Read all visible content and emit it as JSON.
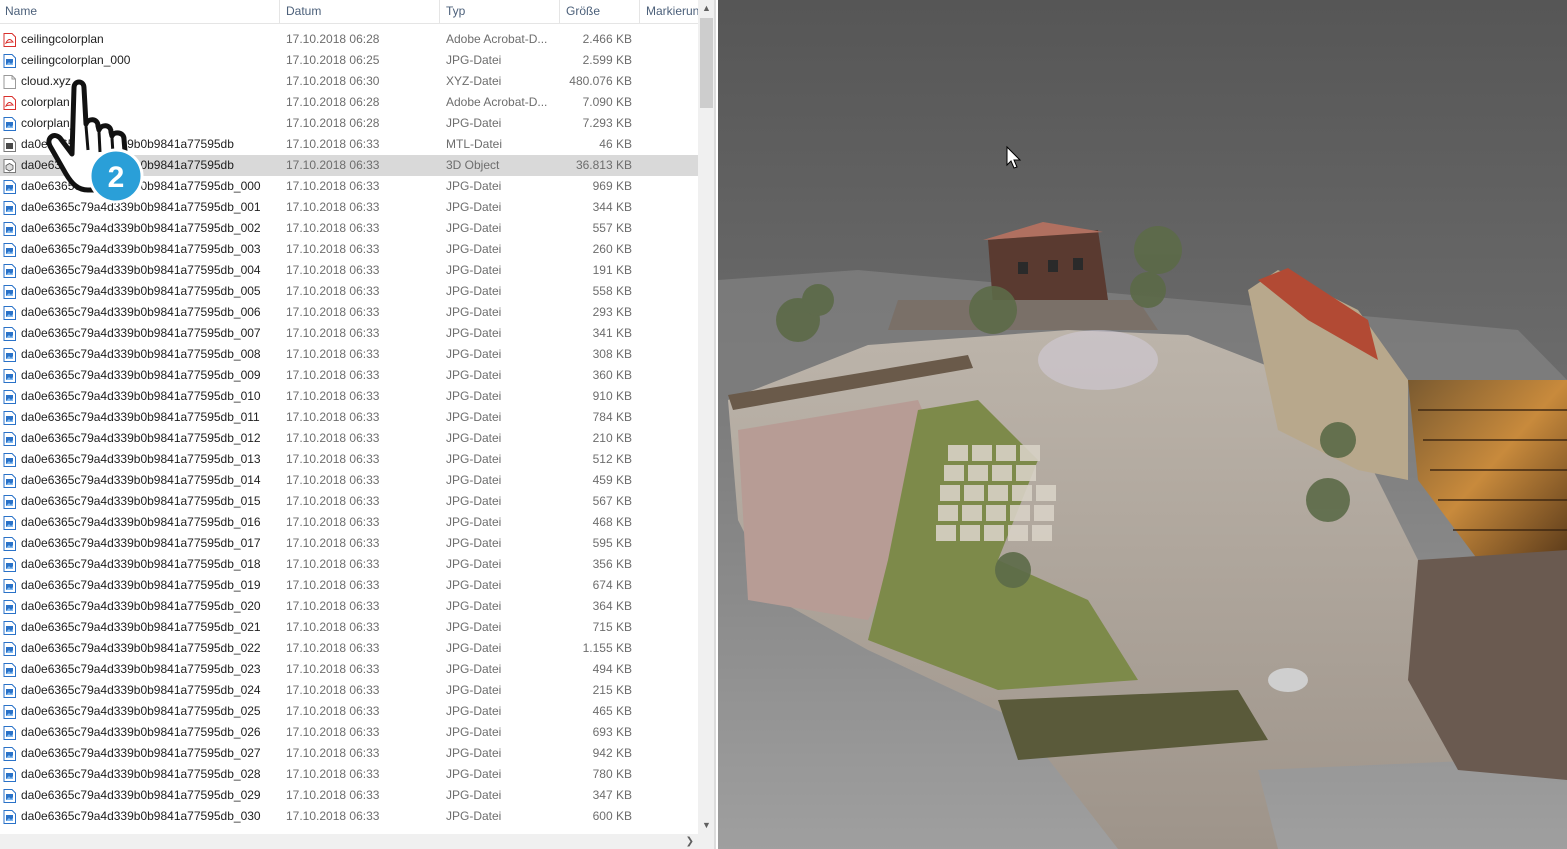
{
  "columns": {
    "name": "Name",
    "date": "Datum",
    "type": "Typ",
    "size": "Größe",
    "tags": "Markierun"
  },
  "icons": {
    "sort": "sort-up-icon",
    "pdf": "pdf-file-icon",
    "jpg": "image-file-icon",
    "xyz": "blank-file-icon",
    "mtl": "mtl-file-icon",
    "obj": "3d-object-icon",
    "pointer": "hand-pointer-icon",
    "badge_number": "2"
  },
  "colors": {
    "selected_row": "#d9d9d9",
    "pdf_red": "#d9302c",
    "image_blue": "#2a72c8",
    "badge_blue": "#2a9fd8",
    "viewer_bg": "#5a5a5a"
  },
  "files": [
    {
      "name": "ceilingcolorplan",
      "date": "17.10.2018 06:28",
      "type": "Adobe Acrobat-D...",
      "size": "2.466 KB",
      "icon": "pdf"
    },
    {
      "name": "ceilingcolorplan_000",
      "date": "17.10.2018 06:25",
      "type": "JPG-Datei",
      "size": "2.599 KB",
      "icon": "jpg"
    },
    {
      "name": "cloud.xyz",
      "date": "17.10.2018 06:30",
      "type": "XYZ-Datei",
      "size": "480.076 KB",
      "icon": "xyz"
    },
    {
      "name": "colorplan",
      "date": "17.10.2018 06:28",
      "type": "Adobe Acrobat-D...",
      "size": "7.090 KB",
      "icon": "pdf"
    },
    {
      "name": "colorplan_000",
      "date": "17.10.2018 06:28",
      "type": "JPG-Datei",
      "size": "7.293 KB",
      "icon": "jpg"
    },
    {
      "name": "da0e6365c79a4d339b0b9841a77595db",
      "date": "17.10.2018 06:33",
      "type": "MTL-Datei",
      "size": "46 KB",
      "icon": "mtl"
    },
    {
      "name": "da0e6365c79a4d339b0b9841a77595db",
      "date": "17.10.2018 06:33",
      "type": "3D Object",
      "size": "36.813 KB",
      "icon": "obj",
      "selected": true
    },
    {
      "name": "da0e6365c79a4d339b0b9841a77595db_000",
      "date": "17.10.2018 06:33",
      "type": "JPG-Datei",
      "size": "969 KB",
      "icon": "jpg"
    },
    {
      "name": "da0e6365c79a4d339b0b9841a77595db_001",
      "date": "17.10.2018 06:33",
      "type": "JPG-Datei",
      "size": "344 KB",
      "icon": "jpg"
    },
    {
      "name": "da0e6365c79a4d339b0b9841a77595db_002",
      "date": "17.10.2018 06:33",
      "type": "JPG-Datei",
      "size": "557 KB",
      "icon": "jpg"
    },
    {
      "name": "da0e6365c79a4d339b0b9841a77595db_003",
      "date": "17.10.2018 06:33",
      "type": "JPG-Datei",
      "size": "260 KB",
      "icon": "jpg"
    },
    {
      "name": "da0e6365c79a4d339b0b9841a77595db_004",
      "date": "17.10.2018 06:33",
      "type": "JPG-Datei",
      "size": "191 KB",
      "icon": "jpg"
    },
    {
      "name": "da0e6365c79a4d339b0b9841a77595db_005",
      "date": "17.10.2018 06:33",
      "type": "JPG-Datei",
      "size": "558 KB",
      "icon": "jpg"
    },
    {
      "name": "da0e6365c79a4d339b0b9841a77595db_006",
      "date": "17.10.2018 06:33",
      "type": "JPG-Datei",
      "size": "293 KB",
      "icon": "jpg"
    },
    {
      "name": "da0e6365c79a4d339b0b9841a77595db_007",
      "date": "17.10.2018 06:33",
      "type": "JPG-Datei",
      "size": "341 KB",
      "icon": "jpg"
    },
    {
      "name": "da0e6365c79a4d339b0b9841a77595db_008",
      "date": "17.10.2018 06:33",
      "type": "JPG-Datei",
      "size": "308 KB",
      "icon": "jpg"
    },
    {
      "name": "da0e6365c79a4d339b0b9841a77595db_009",
      "date": "17.10.2018 06:33",
      "type": "JPG-Datei",
      "size": "360 KB",
      "icon": "jpg"
    },
    {
      "name": "da0e6365c79a4d339b0b9841a77595db_010",
      "date": "17.10.2018 06:33",
      "type": "JPG-Datei",
      "size": "910 KB",
      "icon": "jpg"
    },
    {
      "name": "da0e6365c79a4d339b0b9841a77595db_011",
      "date": "17.10.2018 06:33",
      "type": "JPG-Datei",
      "size": "784 KB",
      "icon": "jpg"
    },
    {
      "name": "da0e6365c79a4d339b0b9841a77595db_012",
      "date": "17.10.2018 06:33",
      "type": "JPG-Datei",
      "size": "210 KB",
      "icon": "jpg"
    },
    {
      "name": "da0e6365c79a4d339b0b9841a77595db_013",
      "date": "17.10.2018 06:33",
      "type": "JPG-Datei",
      "size": "512 KB",
      "icon": "jpg"
    },
    {
      "name": "da0e6365c79a4d339b0b9841a77595db_014",
      "date": "17.10.2018 06:33",
      "type": "JPG-Datei",
      "size": "459 KB",
      "icon": "jpg"
    },
    {
      "name": "da0e6365c79a4d339b0b9841a77595db_015",
      "date": "17.10.2018 06:33",
      "type": "JPG-Datei",
      "size": "567 KB",
      "icon": "jpg"
    },
    {
      "name": "da0e6365c79a4d339b0b9841a77595db_016",
      "date": "17.10.2018 06:33",
      "type": "JPG-Datei",
      "size": "468 KB",
      "icon": "jpg"
    },
    {
      "name": "da0e6365c79a4d339b0b9841a77595db_017",
      "date": "17.10.2018 06:33",
      "type": "JPG-Datei",
      "size": "595 KB",
      "icon": "jpg"
    },
    {
      "name": "da0e6365c79a4d339b0b9841a77595db_018",
      "date": "17.10.2018 06:33",
      "type": "JPG-Datei",
      "size": "356 KB",
      "icon": "jpg"
    },
    {
      "name": "da0e6365c79a4d339b0b9841a77595db_019",
      "date": "17.10.2018 06:33",
      "type": "JPG-Datei",
      "size": "674 KB",
      "icon": "jpg"
    },
    {
      "name": "da0e6365c79a4d339b0b9841a77595db_020",
      "date": "17.10.2018 06:33",
      "type": "JPG-Datei",
      "size": "364 KB",
      "icon": "jpg"
    },
    {
      "name": "da0e6365c79a4d339b0b9841a77595db_021",
      "date": "17.10.2018 06:33",
      "type": "JPG-Datei",
      "size": "715 KB",
      "icon": "jpg"
    },
    {
      "name": "da0e6365c79a4d339b0b9841a77595db_022",
      "date": "17.10.2018 06:33",
      "type": "JPG-Datei",
      "size": "1.155 KB",
      "icon": "jpg"
    },
    {
      "name": "da0e6365c79a4d339b0b9841a77595db_023",
      "date": "17.10.2018 06:33",
      "type": "JPG-Datei",
      "size": "494 KB",
      "icon": "jpg"
    },
    {
      "name": "da0e6365c79a4d339b0b9841a77595db_024",
      "date": "17.10.2018 06:33",
      "type": "JPG-Datei",
      "size": "215 KB",
      "icon": "jpg"
    },
    {
      "name": "da0e6365c79a4d339b0b9841a77595db_025",
      "date": "17.10.2018 06:33",
      "type": "JPG-Datei",
      "size": "465 KB",
      "icon": "jpg"
    },
    {
      "name": "da0e6365c79a4d339b0b9841a77595db_026",
      "date": "17.10.2018 06:33",
      "type": "JPG-Datei",
      "size": "693 KB",
      "icon": "jpg"
    },
    {
      "name": "da0e6365c79a4d339b0b9841a77595db_027",
      "date": "17.10.2018 06:33",
      "type": "JPG-Datei",
      "size": "942 KB",
      "icon": "jpg"
    },
    {
      "name": "da0e6365c79a4d339b0b9841a77595db_028",
      "date": "17.10.2018 06:33",
      "type": "JPG-Datei",
      "size": "780 KB",
      "icon": "jpg"
    },
    {
      "name": "da0e6365c79a4d339b0b9841a77595db_029",
      "date": "17.10.2018 06:33",
      "type": "JPG-Datei",
      "size": "347 KB",
      "icon": "jpg"
    },
    {
      "name": "da0e6365c79a4d339b0b9841a77595db_030",
      "date": "17.10.2018 06:33",
      "type": "JPG-Datei",
      "size": "600 KB",
      "icon": "jpg"
    }
  ]
}
